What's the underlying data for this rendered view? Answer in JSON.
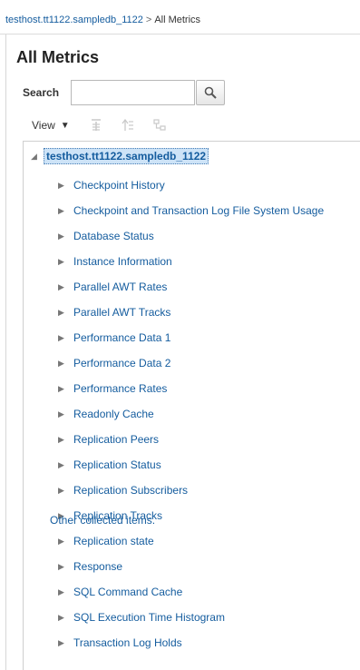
{
  "breadcrumb": {
    "parent": "testhost.tt1122.sampledb_1122",
    "separator": ">",
    "current": "All Metrics"
  },
  "page": {
    "title": "All Metrics"
  },
  "search": {
    "label": "Search",
    "value": "",
    "placeholder": ""
  },
  "toolbar": {
    "view_label": "View"
  },
  "tree": {
    "root_label": "testhost.tt1122.sampledb_1122",
    "items": [
      "Checkpoint History",
      "Checkpoint and Transaction Log File System Usage",
      "Database Status",
      "Instance Information",
      "Parallel AWT Rates",
      "Parallel AWT Tracks",
      "Performance Data 1",
      "Performance Data 2",
      "Performance Rates",
      "Readonly Cache",
      "Replication Peers",
      "Replication Status",
      "Replication Subscribers",
      "Replication Tracks",
      "Replication state",
      "Response",
      "SQL Command Cache",
      "SQL Execution Time Histogram",
      "Transaction Log Holds"
    ],
    "other_label": "Other collected items."
  },
  "colors": {
    "link": "#145c9e",
    "selection": "#cde3f7",
    "border": "#cfcfcf"
  }
}
